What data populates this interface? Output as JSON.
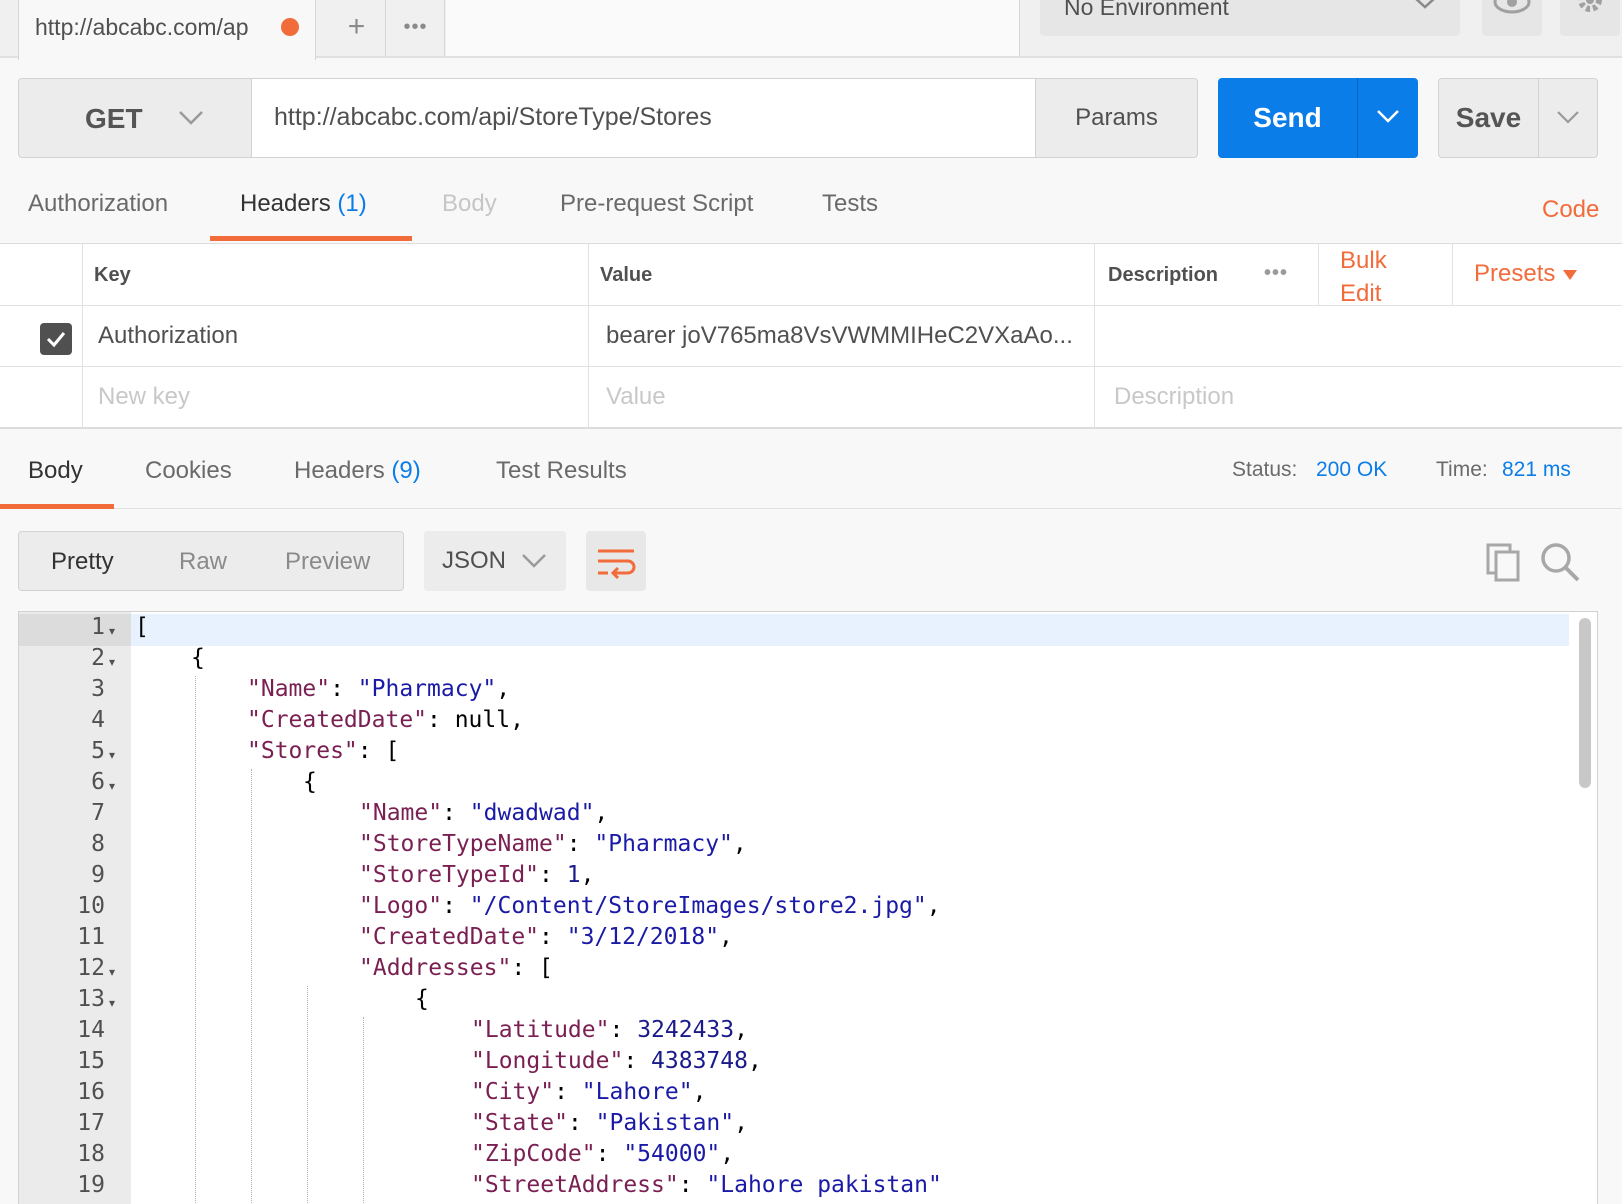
{
  "tabbar": {
    "tab_title": "http://abcabc.com/ap",
    "add_label": "+",
    "more_label": "•••",
    "environment": "No Environment"
  },
  "request": {
    "method": "GET",
    "url": "http://abcabc.com/api/StoreType/Stores",
    "params_label": "Params",
    "send_label": "Send",
    "save_label": "Save"
  },
  "request_tabs": {
    "authorization": "Authorization",
    "headers": "Headers",
    "headers_count": "(1)",
    "body": "Body",
    "prerequest": "Pre-request Script",
    "tests": "Tests",
    "code": "Code"
  },
  "headers_table": {
    "col_key": "Key",
    "col_value": "Value",
    "col_description": "Description",
    "more": "•••",
    "bulk_edit_1": "Bulk",
    "bulk_edit_2": "Edit",
    "presets": "Presets",
    "row": {
      "key": "Authorization",
      "value": "bearer joV765ma8VsVWMMIHeC2VXaAo...",
      "checked": true
    },
    "new_key_placeholder": "New key",
    "new_value_placeholder": "Value",
    "new_description_placeholder": "Description"
  },
  "response_tabs": {
    "body": "Body",
    "cookies": "Cookies",
    "headers": "Headers",
    "headers_count": "(9)",
    "test_results": "Test Results",
    "status_label": "Status:",
    "status_value": "200 OK",
    "time_label": "Time:",
    "time_value": "821 ms"
  },
  "response_toolbar": {
    "pretty": "Pretty",
    "raw": "Raw",
    "preview": "Preview",
    "format": "JSON"
  },
  "colors": {
    "accent_orange": "#f26b3a",
    "send_blue": "#0b7de9"
  },
  "code_lines": [
    {
      "n": "1",
      "fold": true,
      "indent": 0,
      "parts": [
        [
          "p",
          "["
        ]
      ]
    },
    {
      "n": "2",
      "fold": true,
      "indent": 1,
      "parts": [
        [
          "p",
          "{"
        ]
      ]
    },
    {
      "n": "3",
      "fold": false,
      "indent": 2,
      "parts": [
        [
          "k",
          "\"Name\""
        ],
        [
          "p",
          ": "
        ],
        [
          "s",
          "\"Pharmacy\""
        ],
        [
          "p",
          ","
        ]
      ]
    },
    {
      "n": "4",
      "fold": false,
      "indent": 2,
      "parts": [
        [
          "k",
          "\"CreatedDate\""
        ],
        [
          "p",
          ": null,"
        ]
      ]
    },
    {
      "n": "5",
      "fold": true,
      "indent": 2,
      "parts": [
        [
          "k",
          "\"Stores\""
        ],
        [
          "p",
          ": ["
        ]
      ]
    },
    {
      "n": "6",
      "fold": true,
      "indent": 3,
      "parts": [
        [
          "p",
          "{"
        ]
      ]
    },
    {
      "n": "7",
      "fold": false,
      "indent": 4,
      "parts": [
        [
          "k",
          "\"Name\""
        ],
        [
          "p",
          ": "
        ],
        [
          "s",
          "\"dwadwad\""
        ],
        [
          "p",
          ","
        ]
      ]
    },
    {
      "n": "8",
      "fold": false,
      "indent": 4,
      "parts": [
        [
          "k",
          "\"StoreTypeName\""
        ],
        [
          "p",
          ": "
        ],
        [
          "s",
          "\"Pharmacy\""
        ],
        [
          "p",
          ","
        ]
      ]
    },
    {
      "n": "9",
      "fold": false,
      "indent": 4,
      "parts": [
        [
          "k",
          "\"StoreTypeId\""
        ],
        [
          "p",
          ": "
        ],
        [
          "n",
          "1"
        ],
        [
          "p",
          ","
        ]
      ]
    },
    {
      "n": "10",
      "fold": false,
      "indent": 4,
      "parts": [
        [
          "k",
          "\"Logo\""
        ],
        [
          "p",
          ": "
        ],
        [
          "s",
          "\"/Content/StoreImages/store2.jpg\""
        ],
        [
          "p",
          ","
        ]
      ]
    },
    {
      "n": "11",
      "fold": false,
      "indent": 4,
      "parts": [
        [
          "k",
          "\"CreatedDate\""
        ],
        [
          "p",
          ": "
        ],
        [
          "s",
          "\"3/12/2018\""
        ],
        [
          "p",
          ","
        ]
      ]
    },
    {
      "n": "12",
      "fold": true,
      "indent": 4,
      "parts": [
        [
          "k",
          "\"Addresses\""
        ],
        [
          "p",
          ": ["
        ]
      ]
    },
    {
      "n": "13",
      "fold": true,
      "indent": 5,
      "parts": [
        [
          "p",
          "{"
        ]
      ]
    },
    {
      "n": "14",
      "fold": false,
      "indent": 6,
      "parts": [
        [
          "k",
          "\"Latitude\""
        ],
        [
          "p",
          ": "
        ],
        [
          "n",
          "3242433"
        ],
        [
          "p",
          ","
        ]
      ]
    },
    {
      "n": "15",
      "fold": false,
      "indent": 6,
      "parts": [
        [
          "k",
          "\"Longitude\""
        ],
        [
          "p",
          ": "
        ],
        [
          "n",
          "4383748"
        ],
        [
          "p",
          ","
        ]
      ]
    },
    {
      "n": "16",
      "fold": false,
      "indent": 6,
      "parts": [
        [
          "k",
          "\"City\""
        ],
        [
          "p",
          ": "
        ],
        [
          "s",
          "\"Lahore\""
        ],
        [
          "p",
          ","
        ]
      ]
    },
    {
      "n": "17",
      "fold": false,
      "indent": 6,
      "parts": [
        [
          "k",
          "\"State\""
        ],
        [
          "p",
          ": "
        ],
        [
          "s",
          "\"Pakistan\""
        ],
        [
          "p",
          ","
        ]
      ]
    },
    {
      "n": "18",
      "fold": false,
      "indent": 6,
      "parts": [
        [
          "k",
          "\"ZipCode\""
        ],
        [
          "p",
          ": "
        ],
        [
          "s",
          "\"54000\""
        ],
        [
          "p",
          ","
        ]
      ]
    },
    {
      "n": "19",
      "fold": false,
      "indent": 6,
      "parts": [
        [
          "k",
          "\"StreetAddress\""
        ],
        [
          "p",
          ": "
        ],
        [
          "s",
          "\"Lahore pakistan\""
        ]
      ]
    }
  ]
}
